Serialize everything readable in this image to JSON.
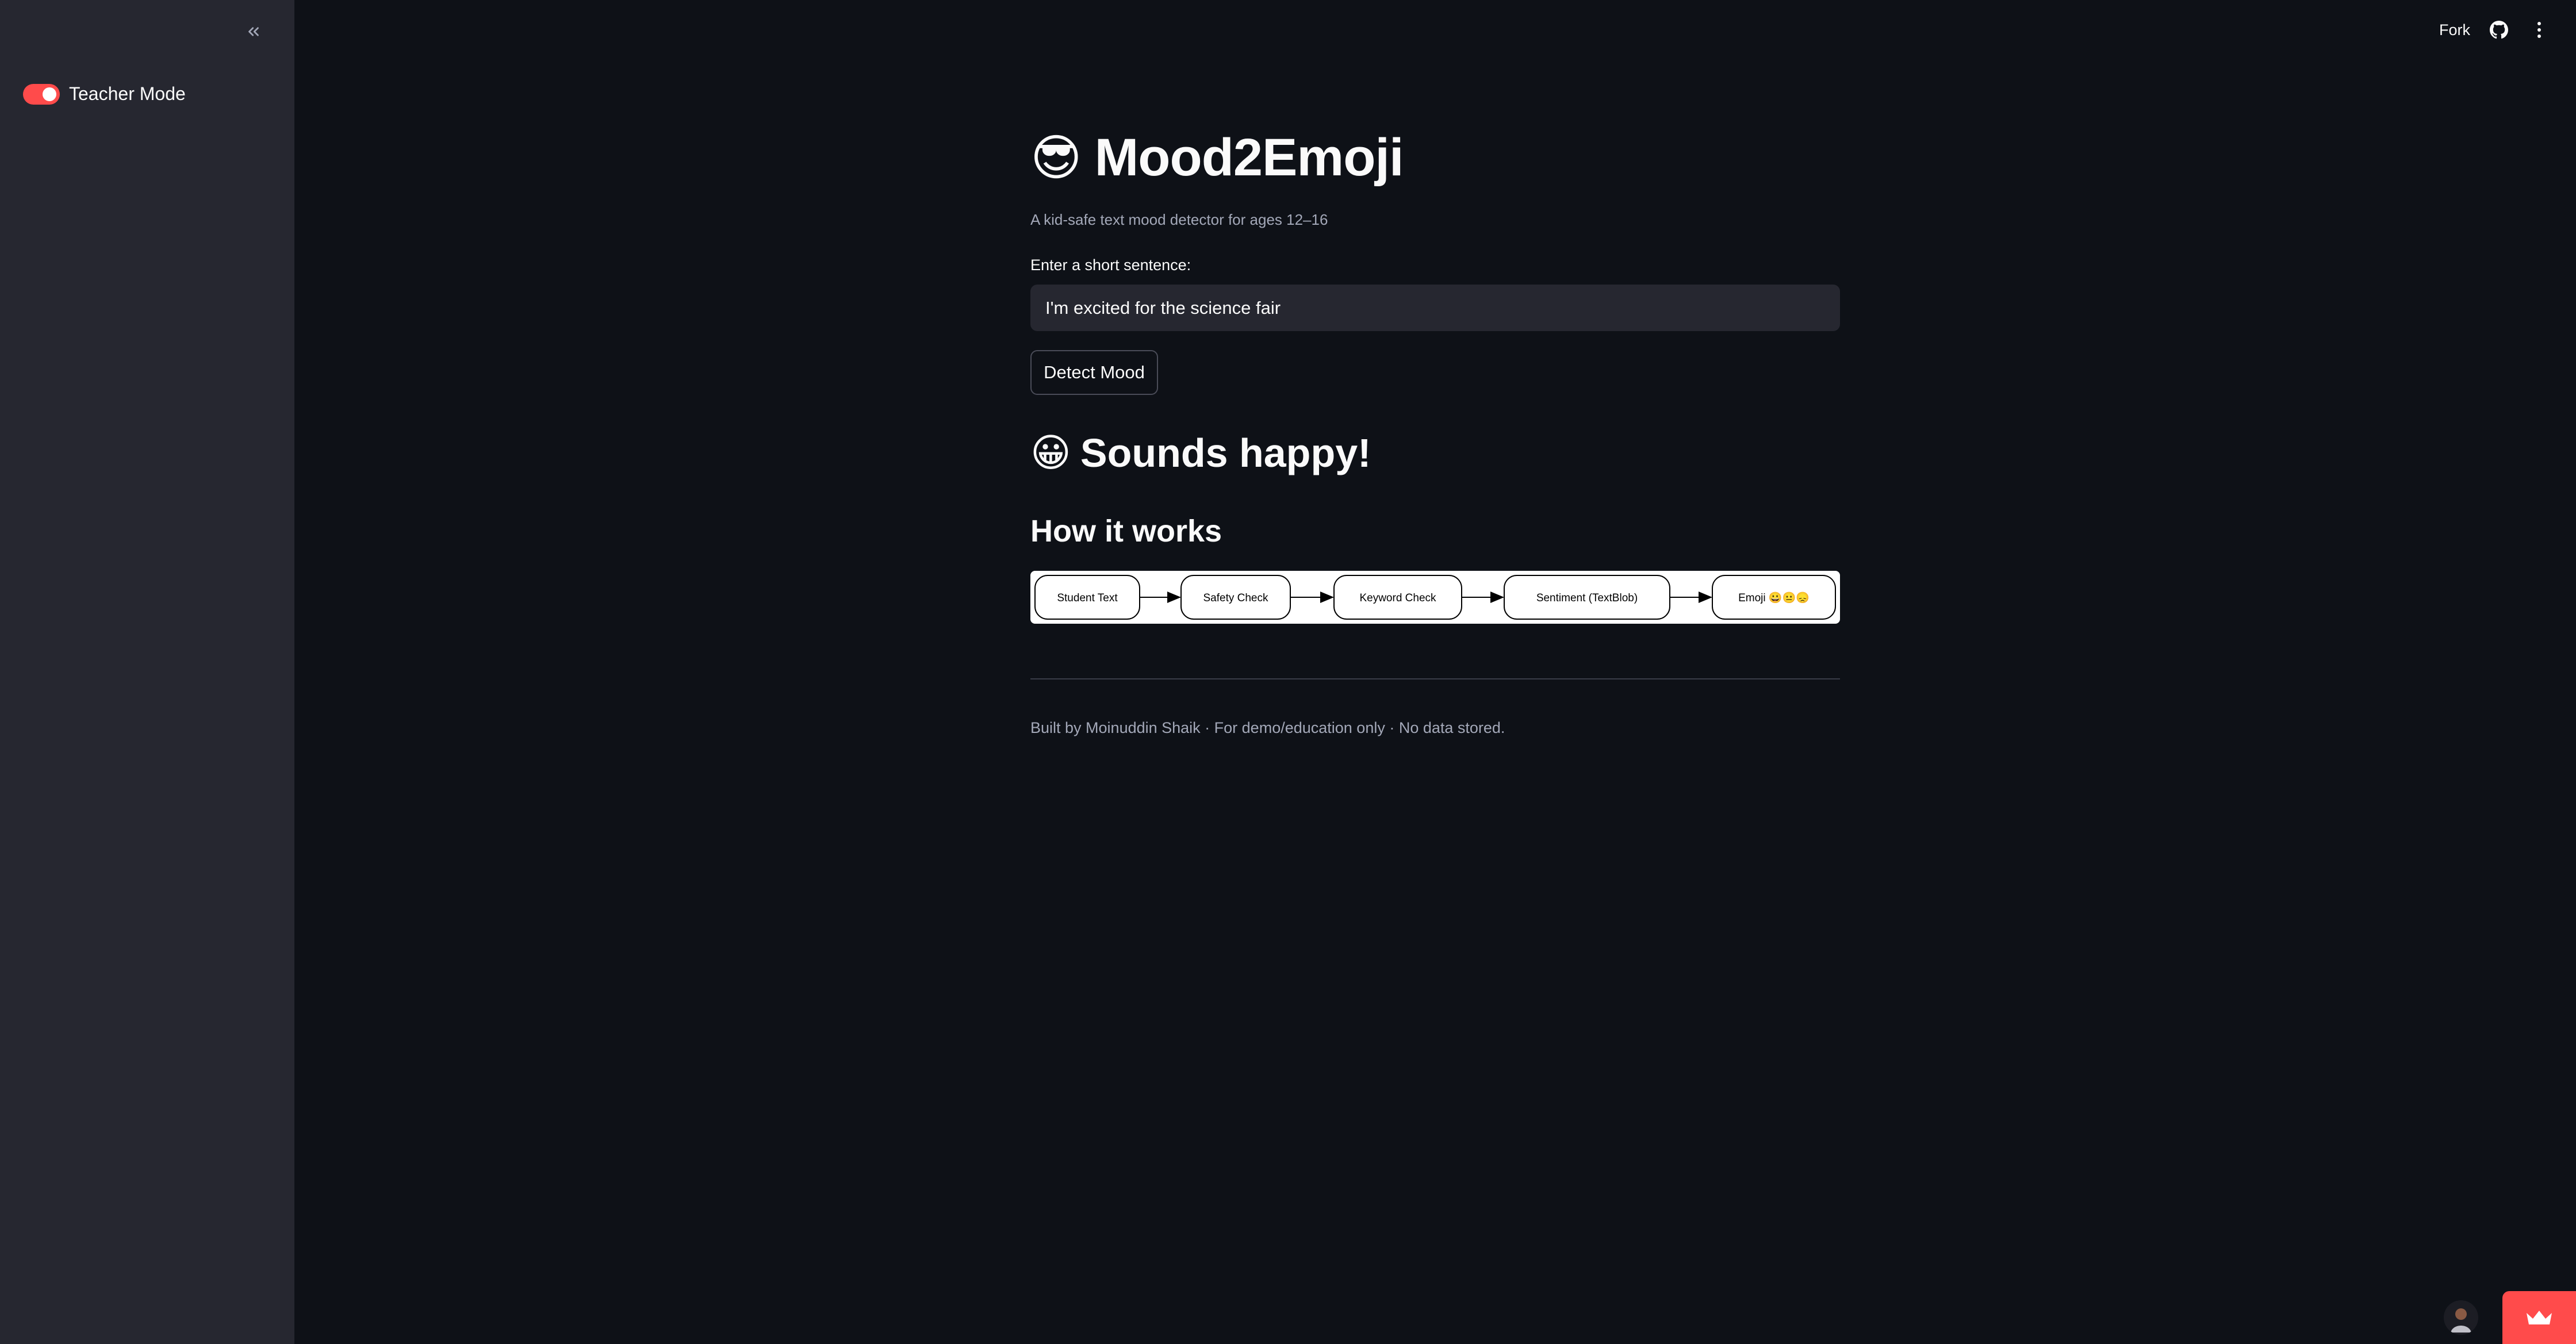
{
  "sidebar": {
    "toggle_label": "Teacher Mode",
    "toggle_on": true,
    "toggle_color": "#ff4b4b"
  },
  "topbar": {
    "fork_label": "Fork",
    "github_icon": "github-icon",
    "menu_icon": "kebab-menu-icon"
  },
  "app": {
    "title_emoji": "😎",
    "title": "Mood2Emoji",
    "subtitle": "A kid-safe text mood detector for ages 12–16",
    "input_label": "Enter a short sentence:",
    "input_value": "I'm excited for the science fair",
    "button_label": "Detect Mood",
    "result_emoji": "😀",
    "result_text": "Sounds happy!",
    "how_heading": "How it works",
    "flow_steps": [
      "Student Text",
      "Safety Check",
      "Keyword Check",
      "Sentiment (TextBlob)",
      "Emoji 😀😐😞"
    ],
    "footer": "Built by Moinuddin Shaik · For demo/education only · No data stored."
  },
  "colors": {
    "background": "#0e1117",
    "sidebar": "#262730",
    "accent": "#ff4b4b",
    "muted_text": "#a3a8b8"
  }
}
